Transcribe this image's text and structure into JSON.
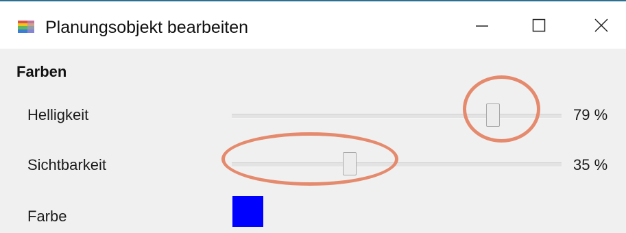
{
  "window": {
    "title": "Planungsobjekt bearbeiten",
    "icon": "app-colorbars-icon",
    "controls": {
      "minimize": "minimize-icon",
      "maximize": "maximize-icon",
      "close": "close-icon"
    }
  },
  "section": {
    "title": "Farben"
  },
  "rows": [
    {
      "label": "Helligkeit",
      "value": 79,
      "value_text": "79 %"
    },
    {
      "label": "Sichtbarkeit",
      "value": 35,
      "value_text": "35 %"
    },
    {
      "label": "Farbe",
      "color": "#0000ff"
    }
  ],
  "colors": {
    "annotation_ring": "#e58a6d",
    "window_bg": "#f0f0f0",
    "title_accent": "#2b6f91"
  }
}
